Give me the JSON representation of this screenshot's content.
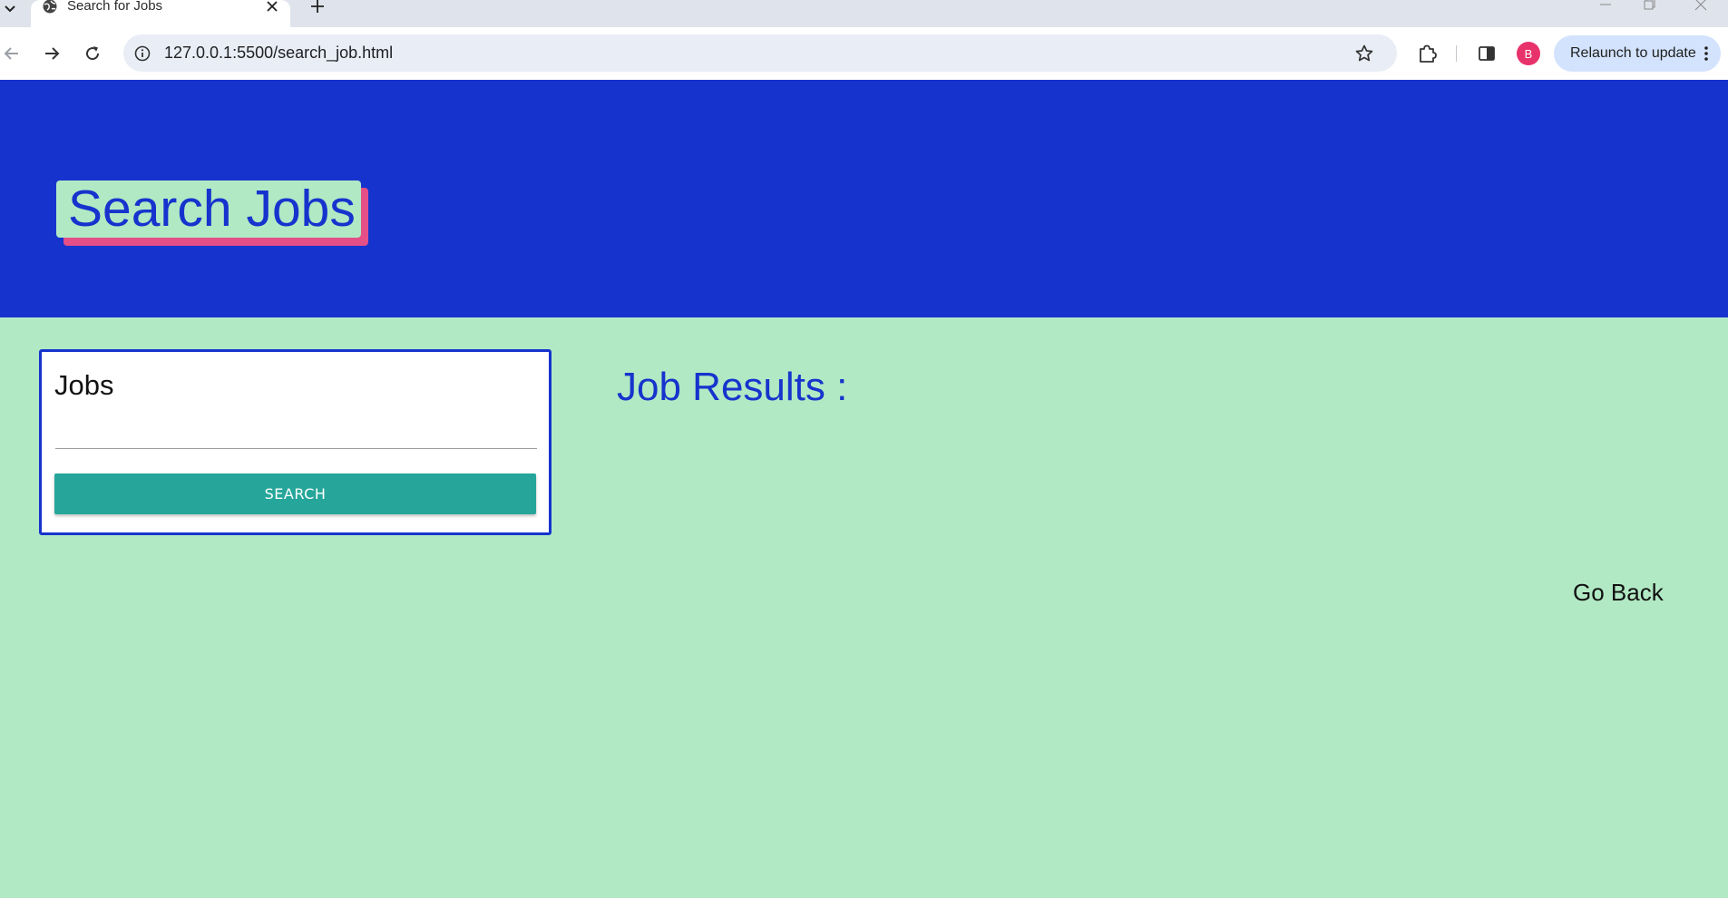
{
  "browser": {
    "tab": {
      "title": "Search for Jobs"
    },
    "address": {
      "url": "127.0.0.1:5500/search_job.html"
    },
    "profile": {
      "initial": "B"
    },
    "relaunch": {
      "label": "Relaunch to update"
    }
  },
  "page": {
    "hero": {
      "title": "Search Jobs"
    },
    "search": {
      "label": "Jobs",
      "value": "",
      "button_label": "SEARCH"
    },
    "results": {
      "heading": "Job Results :"
    },
    "nav": {
      "go_back": "Go Back"
    }
  },
  "colors": {
    "hero_background": "#1634cd",
    "page_background": "#b1e9c4",
    "title_shadow": "#e34f86",
    "button": "#26a69a",
    "avatar": "#e8326c"
  },
  "icons": {
    "tab": "globe-icon",
    "close": "close-icon",
    "new_tab": "plus-icon",
    "back": "arrow-left-icon",
    "forward": "arrow-right-icon",
    "reload": "reload-icon",
    "site_info": "info-icon",
    "bookmark": "star-icon",
    "extensions": "puzzle-icon",
    "side_panel": "side-panel-icon",
    "menu": "kebab-menu-icon"
  }
}
